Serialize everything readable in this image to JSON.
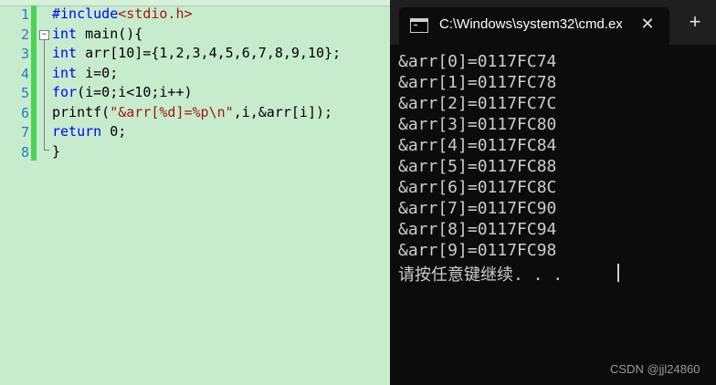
{
  "editor": {
    "line_numbers": [
      "1",
      "2",
      "3",
      "4",
      "5",
      "6",
      "7",
      "8"
    ],
    "fold_toggle": "−",
    "lines": [
      {
        "parts": [
          {
            "t": "#include",
            "c": "pp"
          },
          {
            "t": "<stdio.h>",
            "c": "inc"
          }
        ]
      },
      {
        "parts": [
          {
            "t": "int",
            "c": "kw"
          },
          {
            "t": " main(){",
            "c": ""
          }
        ]
      },
      {
        "parts": [
          {
            "t": "int",
            "c": "kw"
          },
          {
            "t": " arr[10]={1,2,3,4,5,6,7,8,9,10};",
            "c": ""
          }
        ]
      },
      {
        "parts": [
          {
            "t": "int",
            "c": "kw"
          },
          {
            "t": " i=0;",
            "c": ""
          }
        ]
      },
      {
        "parts": [
          {
            "t": "for",
            "c": "kw"
          },
          {
            "t": "(i=0;i<10;i++)",
            "c": ""
          }
        ]
      },
      {
        "parts": [
          {
            "t": "printf(",
            "c": ""
          },
          {
            "t": "\"&arr[%d]=%p\\n\"",
            "c": "str"
          },
          {
            "t": ",i,&arr[i]);",
            "c": ""
          }
        ]
      },
      {
        "parts": [
          {
            "t": "return",
            "c": "kw"
          },
          {
            "t": " 0;",
            "c": ""
          }
        ]
      },
      {
        "parts": [
          {
            "t": "}",
            "c": ""
          }
        ]
      }
    ]
  },
  "terminal": {
    "tab_title": "C:\\Windows\\system32\\cmd.ex",
    "close_glyph": "✕",
    "new_tab_glyph": "+",
    "output": [
      "&arr[0]=0117FC74",
      "&arr[1]=0117FC78",
      "&arr[2]=0117FC7C",
      "&arr[3]=0117FC80",
      "&arr[4]=0117FC84",
      "&arr[5]=0117FC88",
      "&arr[6]=0117FC8C",
      "&arr[7]=0117FC90",
      "&arr[8]=0117FC94",
      "&arr[9]=0117FC98",
      "请按任意键继续. . ."
    ],
    "watermark": "CSDN @jjl24860"
  }
}
